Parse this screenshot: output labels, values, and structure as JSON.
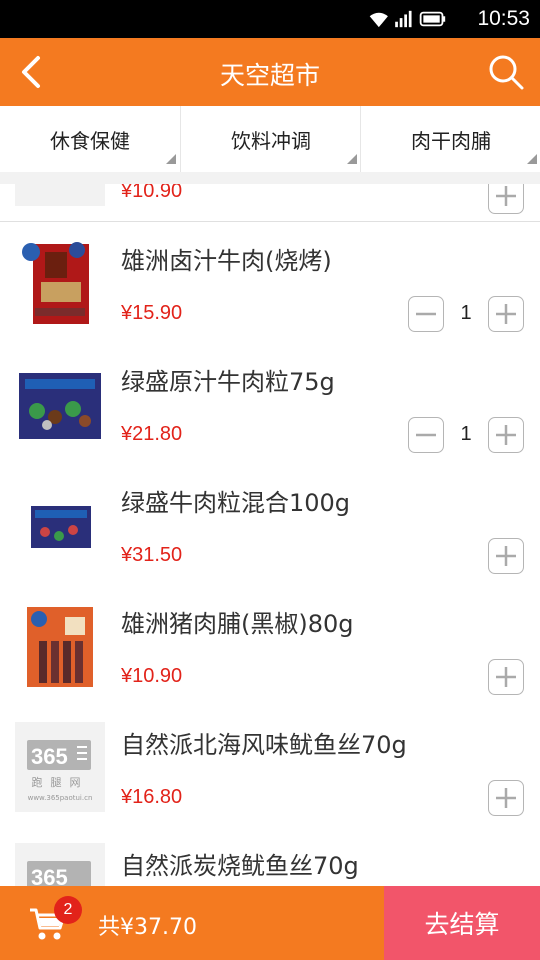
{
  "status_bar": {
    "time": "10:53"
  },
  "header": {
    "title": "天空超市",
    "back_icon": "back-arrow-icon",
    "search_icon": "search-icon"
  },
  "tabs": [
    {
      "label": "休食保健"
    },
    {
      "label": "饮料冲调"
    },
    {
      "label": "肉干肉脯"
    }
  ],
  "products": [
    {
      "name": "",
      "price": "¥10.90",
      "quantity": null
    },
    {
      "name": "雄洲卤汁牛肉(烧烤)",
      "price": "¥15.90",
      "quantity": "1"
    },
    {
      "name": "绿盛原汁牛肉粒75g",
      "price": "¥21.80",
      "quantity": "1"
    },
    {
      "name": "绿盛牛肉粒混合100g",
      "price": "¥31.50",
      "quantity": null
    },
    {
      "name": "雄洲猪肉脯(黑椒)80g",
      "price": "¥10.90",
      "quantity": null
    },
    {
      "name": "自然派北海风味鱿鱼丝70g",
      "price": "¥16.80",
      "quantity": null
    },
    {
      "name": "自然派炭烧鱿鱼丝70g",
      "price": "",
      "quantity": null
    }
  ],
  "placeholder_image": {
    "brand": "365",
    "subtext": "跑腿网",
    "url_text": "www.365paotui.cn"
  },
  "cart": {
    "count": "2",
    "total": "共¥37.70",
    "checkout_label": "去结算"
  },
  "colors": {
    "primary": "#f47a20",
    "price": "#e2231a",
    "checkout": "#f2556a"
  }
}
